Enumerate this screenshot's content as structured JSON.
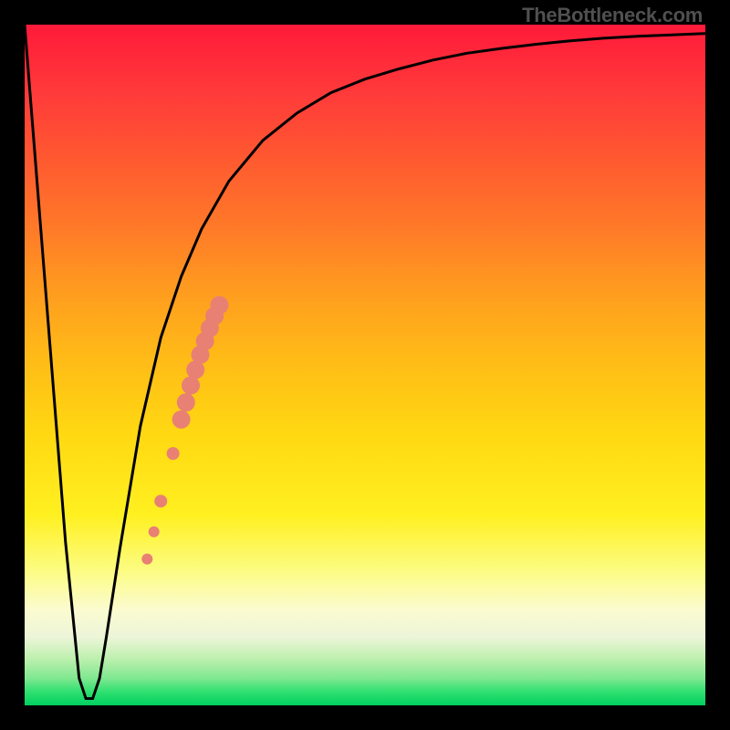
{
  "attribution": "TheBottleneck.com",
  "chart_data": {
    "type": "line",
    "title": "",
    "xlabel": "",
    "ylabel": "",
    "xlim": [
      0,
      100
    ],
    "ylim": [
      0,
      100
    ],
    "series": [
      {
        "name": "bottleneck-curve",
        "x": [
          0,
          3,
          6,
          8,
          9,
          10,
          11,
          12,
          14,
          17,
          20,
          23,
          26,
          30,
          35,
          40,
          45,
          50,
          55,
          60,
          65,
          70,
          75,
          80,
          85,
          90,
          95,
          100
        ],
        "y": [
          100,
          62,
          24,
          4,
          1,
          1,
          4,
          10,
          23,
          41,
          54,
          63,
          70,
          77,
          83,
          87,
          90,
          92,
          93.5,
          94.8,
          95.8,
          96.5,
          97.1,
          97.6,
          98.0,
          98.3,
          98.5,
          98.7
        ]
      }
    ],
    "markers": {
      "name": "highlight-segment",
      "color": "#e88074",
      "points": [
        {
          "x": 18.0,
          "y": 21.5,
          "r": 6
        },
        {
          "x": 19.0,
          "y": 25.5,
          "r": 6
        },
        {
          "x": 20.0,
          "y": 30.0,
          "r": 7
        },
        {
          "x": 21.8,
          "y": 37.0,
          "r": 7
        },
        {
          "x": 23.0,
          "y": 42.0,
          "r": 10
        },
        {
          "x": 23.7,
          "y": 44.5,
          "r": 10
        },
        {
          "x": 24.4,
          "y": 47.0,
          "r": 10
        },
        {
          "x": 25.1,
          "y": 49.3,
          "r": 10
        },
        {
          "x": 25.8,
          "y": 51.5,
          "r": 10
        },
        {
          "x": 26.5,
          "y": 53.5,
          "r": 10
        },
        {
          "x": 27.2,
          "y": 55.4,
          "r": 10
        },
        {
          "x": 27.9,
          "y": 57.2,
          "r": 10
        },
        {
          "x": 28.6,
          "y": 58.8,
          "r": 10
        }
      ]
    }
  }
}
